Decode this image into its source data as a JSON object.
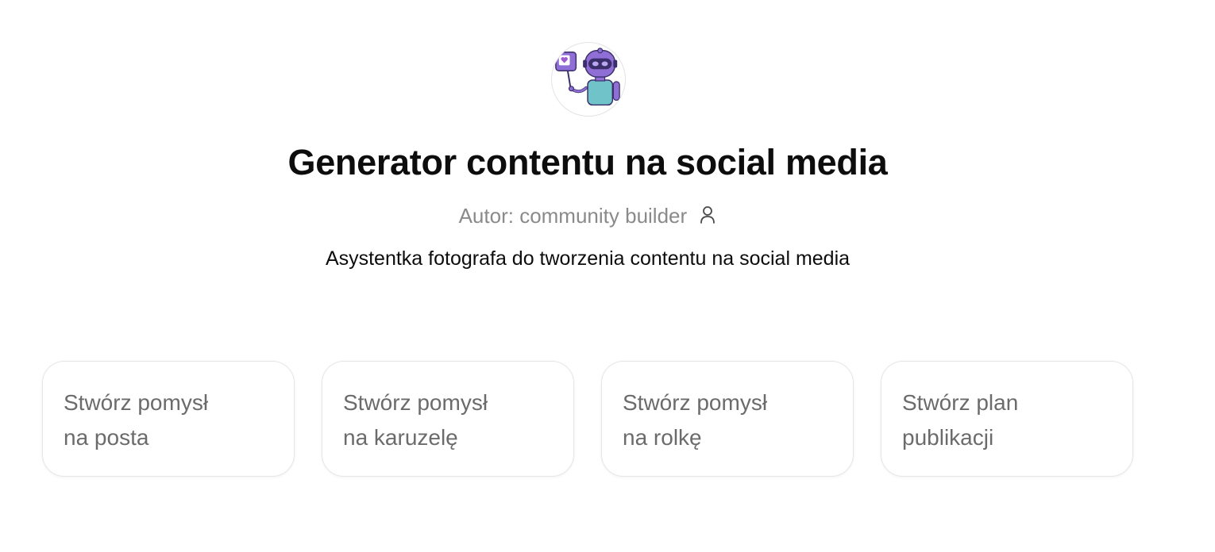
{
  "gpt": {
    "title": "Generator contentu na social media",
    "author_prefix": "Autor: ",
    "author_name": "community builder",
    "description": "Asystentka fotografa do tworzenia contentu na social media",
    "avatar_icon": "robot-holding-like-sign-icon"
  },
  "conversation_starters": [
    {
      "line1": "Stwórz pomysł",
      "line2": "na posta"
    },
    {
      "line1": "Stwórz pomysł",
      "line2": "na karuzelę"
    },
    {
      "line1": "Stwórz pomysł",
      "line2": "na rolkę"
    },
    {
      "line1": "Stwórz plan",
      "line2": "publikacji"
    }
  ],
  "colors": {
    "accent_purple": "#7b5cc7",
    "robot_teal": "#6fc3c9",
    "text_primary": "#0d0d0d",
    "text_muted": "#8a8a8a"
  }
}
